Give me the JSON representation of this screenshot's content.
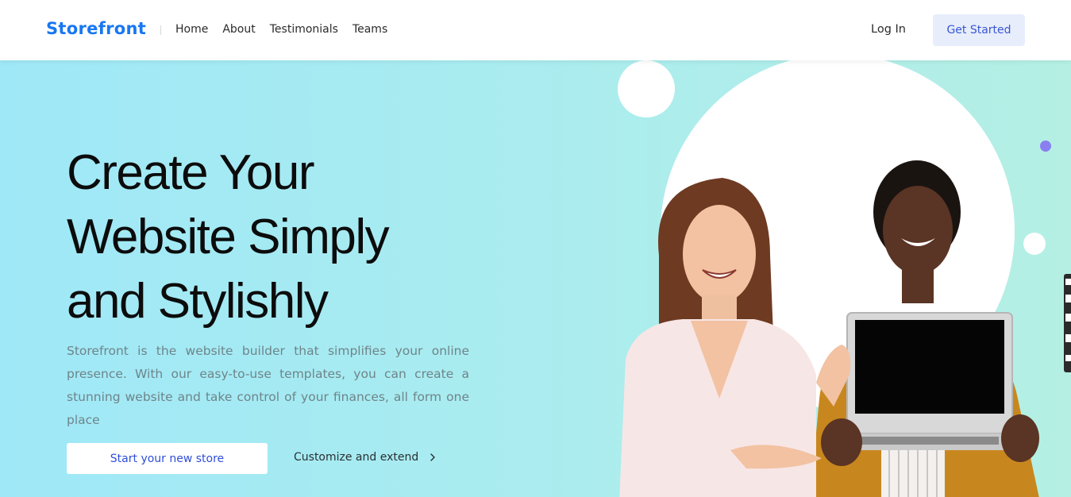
{
  "header": {
    "logo": "Storefront",
    "nav": [
      "Home",
      "About",
      "Testimonials",
      "Teams"
    ],
    "login_label": "Log In",
    "cta_label": "Get Started"
  },
  "hero": {
    "headline_lines": [
      "Create Your",
      "Website Simply",
      "and Stylishly"
    ],
    "description": "Storefront is the website builder that simplifies your online presence. With our easy-to-use templates, you can create a stunning website and take control of your finances, all form one place",
    "primary_button": "Start your new store",
    "secondary_link": "Customize and extend"
  },
  "icons": {
    "secondary_link_icon": "chevron-right-icon",
    "side_toolbar_icons": [
      "edit-icon",
      "square-icon",
      "square-icon",
      "copy-icon",
      "gear-icon"
    ]
  },
  "colors": {
    "brand": "#1877f2",
    "cta_bg": "#e7edfb",
    "cta_text": "#3a56d4",
    "hero_gradient_start": "#9fe8f7",
    "hero_gradient_end": "#b5efe4",
    "accent_dot": "#8a7ff0"
  }
}
